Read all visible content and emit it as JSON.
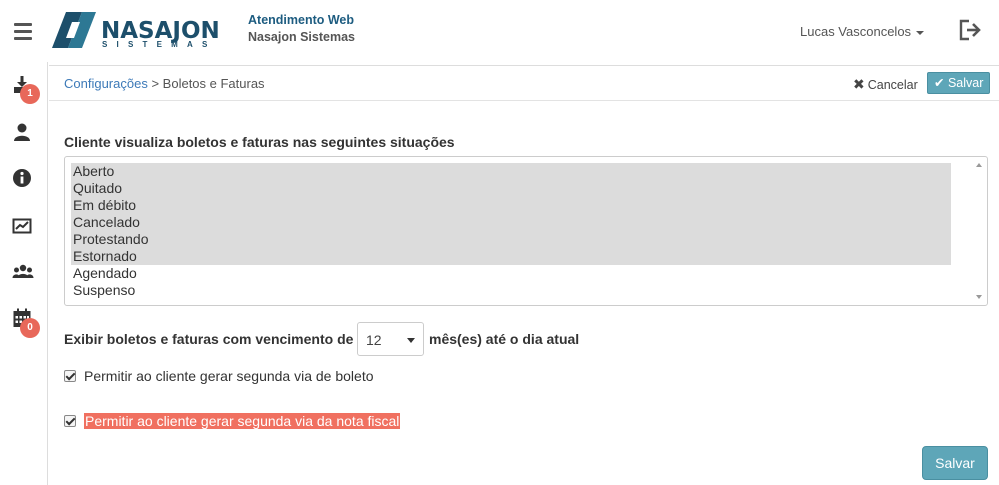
{
  "header": {
    "app_title": "Atendimento Web",
    "app_subtitle": "Nasajon Sistemas",
    "logo_word": "NASAJON",
    "logo_sub": "SISTEMAS",
    "user_name": "Lucas Vasconcelos"
  },
  "sidebar": {
    "items": [
      {
        "name": "download",
        "badge": "1"
      },
      {
        "name": "user"
      },
      {
        "name": "info"
      },
      {
        "name": "chart"
      },
      {
        "name": "group"
      },
      {
        "name": "calendar",
        "badge": "0"
      }
    ],
    "badge_color": "#e8685a"
  },
  "breadcrumb": {
    "parent": "Configurações",
    "separator": ">",
    "current": "Boletos e Faturas"
  },
  "actions": {
    "cancel": "Cancelar",
    "save_top": "Salvar",
    "save_bottom": "Salvar",
    "accent": "#5ea6b8"
  },
  "form": {
    "situations_label": "Cliente visualiza boletos e faturas nas seguintes situações",
    "situations": [
      {
        "label": "Aberto",
        "selected": true
      },
      {
        "label": "Quitado",
        "selected": true
      },
      {
        "label": "Em débito",
        "selected": true
      },
      {
        "label": "Cancelado",
        "selected": true
      },
      {
        "label": "Protestando",
        "selected": true
      },
      {
        "label": "Estornado",
        "selected": true
      },
      {
        "label": "Agendado",
        "selected": false
      },
      {
        "label": "Suspenso",
        "selected": false
      }
    ],
    "vencimento_prefix": "Exibir boletos e faturas com vencimento de",
    "vencimento_value": "12",
    "vencimento_suffix": "mês(es) até o dia atual",
    "checkbox_boleto": {
      "label": "Permitir ao cliente gerar segunda via de boleto",
      "checked": true
    },
    "checkbox_nota": {
      "label": "Permitir ao cliente gerar segunda via da nota fiscal",
      "checked": true
    },
    "highlight_color": "#f07060"
  }
}
